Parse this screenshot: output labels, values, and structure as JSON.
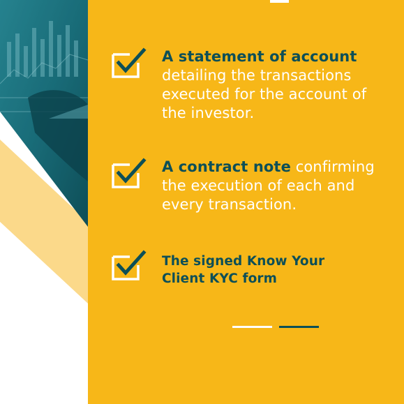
{
  "colors": {
    "accent_yellow": "#F7B718",
    "pale_yellow": "#FBD98A",
    "dark_teal": "#0D4F57",
    "teal": "#1A7A86",
    "white": "#FFFFFF"
  },
  "items": [
    {
      "icon": "checkbox-checked-icon",
      "bold": "A statement of account",
      "rest": " detailing the transactions executed for the account of the investor."
    },
    {
      "icon": "checkbox-checked-icon",
      "bold": "A contract note",
      "rest": " confirming the execution of each and every transaction."
    },
    {
      "icon": "checkbox-checked-icon",
      "bold": "The signed Know Your Client KYC form",
      "rest": ""
    }
  ],
  "pager": {
    "dots": 2,
    "active": 1
  }
}
